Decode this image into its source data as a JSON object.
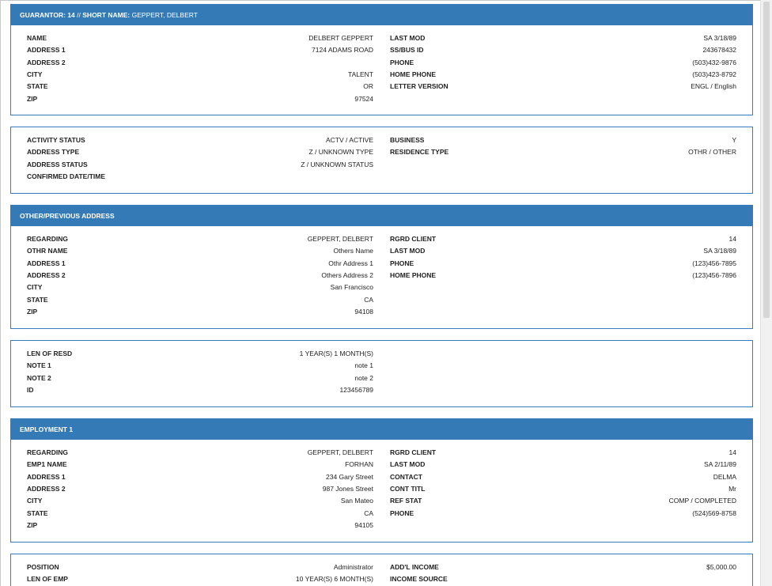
{
  "guarantor_panel": {
    "title_label": "GUARANTOR:",
    "guarantor_id": "14",
    "separator": "//",
    "short_name_label": "SHORT NAME:",
    "short_name": "GEPPERT, DELBERT",
    "left": [
      {
        "label": "NAME",
        "value": "DELBERT GEPPERT"
      },
      {
        "label": "ADDRESS 1",
        "value": "7124 ADAMS ROAD"
      },
      {
        "label": "ADDRESS 2",
        "value": ""
      },
      {
        "label": "CITY",
        "value": "TALENT"
      },
      {
        "label": "STATE",
        "value": "OR"
      },
      {
        "label": "ZIP",
        "value": "97524"
      }
    ],
    "right": [
      {
        "label": "LAST MOD",
        "value": "SA 3/18/89"
      },
      {
        "label": "SS/BUS ID",
        "value": "243678432"
      },
      {
        "label": "PHONE",
        "value": "(503)432-9876"
      },
      {
        "label": "HOME PHONE",
        "value": "(503)423-8792"
      },
      {
        "label": "LETTER VERSION",
        "value": "ENGL / English"
      }
    ]
  },
  "status_panel": {
    "left": [
      {
        "label": "ACTIVITY STATUS",
        "value": "ACTV / ACTIVE"
      },
      {
        "label": "ADDRESS TYPE",
        "value": "Z / UNKNOWN TYPE"
      },
      {
        "label": "ADDRESS STATUS",
        "value": "Z / UNKNOWN STATUS"
      },
      {
        "label": "CONFIRMED DATE/TIME",
        "value": ""
      }
    ],
    "right": [
      {
        "label": "BUSINESS",
        "value": "Y"
      },
      {
        "label": "RESIDENCE TYPE",
        "value": "OTHR / OTHER"
      }
    ]
  },
  "other_address_panel": {
    "title": "OTHER/PREVIOUS ADDRESS",
    "left": [
      {
        "label": "REGARDING",
        "value": "GEPPERT, DELBERT"
      },
      {
        "label": "OTHR NAME",
        "value": "Others Name"
      },
      {
        "label": "ADDRESS 1",
        "value": "Othr Address 1"
      },
      {
        "label": "ADDRESS 2",
        "value": "Others Address 2"
      },
      {
        "label": "CITY",
        "value": "San Francisco"
      },
      {
        "label": "STATE",
        "value": "CA"
      },
      {
        "label": "ZIP",
        "value": "94108"
      }
    ],
    "right": [
      {
        "label": "RGRD CLIENT",
        "value": "14"
      },
      {
        "label": "LAST MOD",
        "value": "SA 3/18/89"
      },
      {
        "label": "PHONE",
        "value": "(123)456-7895"
      },
      {
        "label": "HOME PHONE",
        "value": "(123)456-7896"
      }
    ]
  },
  "residence_panel": {
    "left": [
      {
        "label": "LEN OF RESD",
        "value": "1 YEAR(S) 1 MONTH(S)"
      },
      {
        "label": "NOTE 1",
        "value": "note 1"
      },
      {
        "label": "NOTE 2",
        "value": "note 2"
      },
      {
        "label": "ID",
        "value": "123456789"
      }
    ]
  },
  "employment_panel": {
    "title": "EMPLOYMENT 1",
    "left": [
      {
        "label": "REGARDING",
        "value": "GEPPERT, DELBERT"
      },
      {
        "label": "EMP1 NAME",
        "value": "FORHAN"
      },
      {
        "label": "ADDRESS 1",
        "value": "234 Gary Street"
      },
      {
        "label": "ADDRESS 2",
        "value": "987 Jones Street"
      },
      {
        "label": "CITY",
        "value": "San Mateo"
      },
      {
        "label": "STATE",
        "value": "CA"
      },
      {
        "label": "ZIP",
        "value": "94105"
      }
    ],
    "right": [
      {
        "label": "RGRD CLIENT",
        "value": "14"
      },
      {
        "label": "LAST MOD",
        "value": "SA 2/11/89"
      },
      {
        "label": "CONTACT",
        "value": "DELMA"
      },
      {
        "label": "CONT TITL",
        "value": "Mr"
      },
      {
        "label": "REF STAT",
        "value": "COMP / COMPLETED"
      },
      {
        "label": "PHONE",
        "value": "(524)569-8758"
      }
    ]
  },
  "employment_detail_panel": {
    "left": [
      {
        "label": "POSITION",
        "value": "Administrator"
      },
      {
        "label": "LEN OF EMP",
        "value": "10 YEAR(S) 6 MONTH(S)"
      }
    ],
    "right": [
      {
        "label": "ADD'L INCOME",
        "value": "$5,000.00"
      },
      {
        "label": "INCOME SOURCE",
        "value": ""
      }
    ]
  },
  "colors": {
    "header_blue": "#337ab7",
    "panel_border": "#3a7bbf"
  }
}
